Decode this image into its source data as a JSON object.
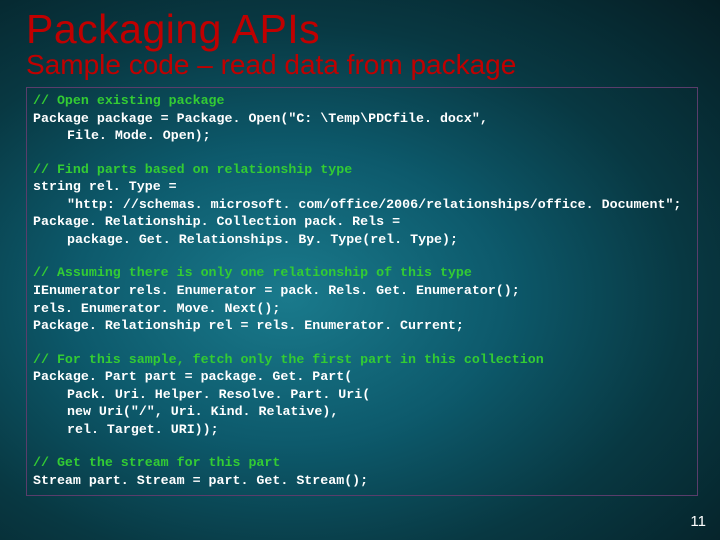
{
  "title": "Packaging APIs",
  "subtitle": "Sample code – read data from package",
  "page_number": "11",
  "code": {
    "c1": "// Open existing package",
    "l1": "Package package = Package. Open(\"C: \\Temp\\PDCfile. docx\",",
    "l1b": "File. Mode. Open);",
    "c2": "// Find parts based on relationship type",
    "l2": "string rel. Type =",
    "l2b": "\"http: //schemas. microsoft. com/office/2006/relationships/office. Document\";",
    "l3": "Package. Relationship. Collection pack. Rels =",
    "l3b": "package. Get. Relationships. By. Type(rel. Type);",
    "c3": "// Assuming there is only one relationship of this type",
    "l4": "IEnumerator rels. Enumerator = pack. Rels. Get. Enumerator();",
    "l5": "rels. Enumerator. Move. Next();",
    "l6": "Package. Relationship rel = rels. Enumerator. Current;",
    "c4": "// For this sample, fetch only the first part in this collection",
    "l7": "Package. Part part = package. Get. Part(",
    "l7b": "Pack. Uri. Helper. Resolve. Part. Uri(",
    "l7c": "new Uri(\"/\", Uri. Kind. Relative),",
    "l7d": "rel. Target. URI));",
    "c5": "// Get the stream for this part",
    "l8": "Stream part. Stream = part. Get. Stream();"
  }
}
